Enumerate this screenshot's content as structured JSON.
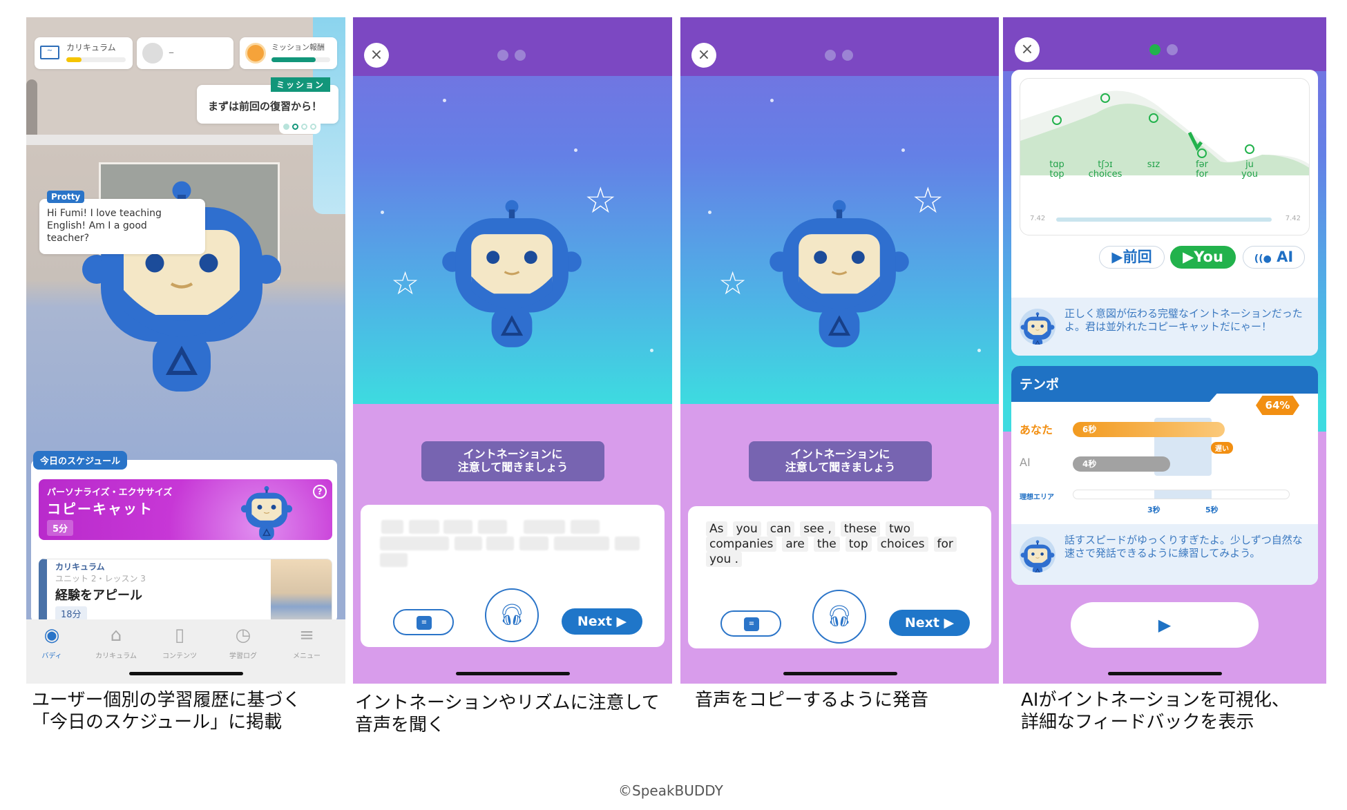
{
  "panel1": {
    "stats": [
      {
        "label": "カリキュラム",
        "progress": 0.25,
        "icon": "laptop-chart-icon",
        "color": "#f5c400"
      },
      {
        "label": "–",
        "icon": "robot-avatar-icon"
      },
      {
        "label": "ミッション報酬",
        "progress": 0.75,
        "icon": "orange-gem-icon",
        "color": "#12967a"
      }
    ],
    "mission": {
      "tag": "ミッション",
      "text": "まずは前回の復習から！",
      "current_page": 2,
      "total_pages": 4
    },
    "speech": {
      "name": "Protty",
      "text": "Hi Fumi! I love teaching English! Am I a good teacher?"
    },
    "schedule": {
      "title": "今日のスケジュール",
      "exercise": {
        "category": "パーソナライズ・エクササイズ",
        "title": "コピーキャット",
        "duration": "5分",
        "help": "?"
      },
      "lesson": {
        "category": "カリキュラム",
        "unit": "ユニット 2・レッスン 3",
        "title": "経験をアピール",
        "duration": "18分"
      }
    },
    "nav": [
      {
        "label": "バディ",
        "icon": "buddy-icon",
        "active": true
      },
      {
        "label": "カリキュラム",
        "icon": "graduation-cap-icon"
      },
      {
        "label": "コンテンツ",
        "icon": "book-icon"
      },
      {
        "label": "学習ログ",
        "icon": "stopwatch-icon"
      },
      {
        "label": "メニュー",
        "icon": "menu-icon"
      }
    ]
  },
  "listen": {
    "close": "×",
    "instruction_line1": "イントネーションに",
    "instruction_line2": "注意して聞きましょう",
    "next": "Next ▶"
  },
  "speak": {
    "words": [
      "As",
      "you",
      "can",
      "see ,",
      "these",
      "two",
      "companies",
      "are",
      "the",
      "top",
      "choices",
      "for",
      "you ."
    ]
  },
  "feedback": {
    "intonation": {
      "syllables": [
        {
          "ipa": "tɑp",
          "word": "top"
        },
        {
          "ipa": "tʃɔɪ",
          "word": "choices"
        },
        {
          "ipa": "sɪz",
          "word": ""
        },
        {
          "ipa": "fər",
          "word": "for"
        },
        {
          "ipa": "ju",
          "word": "you"
        }
      ],
      "time_start": "7.42",
      "time_end": "7.42"
    },
    "buttons": {
      "previous": "前回",
      "you": "You",
      "ai": "AI"
    },
    "comment1": "正しく意図が伝わる完璧なイントネーションだったよ。君は並外れたコピーキャットだにゃー！",
    "tempo": {
      "title": "テンポ",
      "score": "64%",
      "you_label": "あなた",
      "you_value": "6秒",
      "ai_label": "AI",
      "ai_value": "4秒",
      "slow_tag": "遅い",
      "ideal_label": "理想エリア",
      "ideal_min": "3秒",
      "ideal_max": "5秒"
    },
    "comment2": "話すスピードがゆっくりすぎたよ。少しずつ自然な速さで発話できるように練習してみよう。",
    "colors": {
      "accent": "#1f76c9",
      "green": "#22b24c",
      "orange": "#f29a1f",
      "header": "#7c48c2"
    }
  },
  "captions": [
    {
      "line1": "ユーザー個別の学習履歴に基づく",
      "line2": "「今日のスケジュール」に掲載"
    },
    {
      "line1": "イントネーションやリズムに注意して",
      "line2": "音声を聞く"
    },
    {
      "line1": "音声をコピーするように発音",
      "line2": ""
    },
    {
      "line1": "AIがイントネーションを可視化、",
      "line2": "詳細なフィードバックを表示"
    }
  ],
  "copyright": "©SpeakBUDDY"
}
